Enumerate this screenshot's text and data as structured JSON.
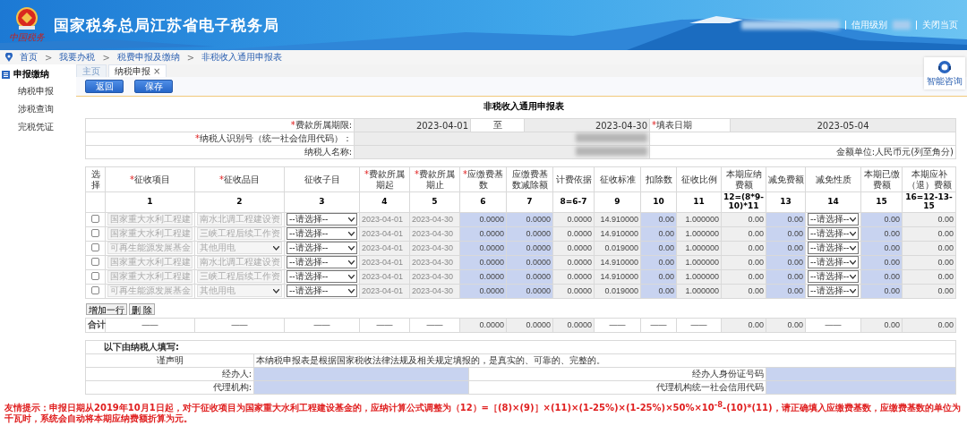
{
  "header": {
    "title": "国家税务总局江苏省电子税务局",
    "logo_text": "中国税务",
    "links": [
      {
        "label": "信用级别"
      },
      {
        "label": "关闭当页"
      }
    ]
  },
  "breadcrumb": [
    {
      "label": "首页"
    },
    {
      "sep": ">",
      "label": "我要办税"
    },
    {
      "sep": ">",
      "label": "税费申报及缴纳"
    },
    {
      "sep": ">",
      "label": "非税收入通用申报表"
    }
  ],
  "sidebar": {
    "title": "申报缴纳",
    "items": [
      {
        "label": "纳税申报"
      },
      {
        "label": "涉税查询"
      },
      {
        "label": "完税凭证"
      }
    ]
  },
  "tabs": [
    {
      "label": "主页",
      "selected": false
    },
    {
      "label": "纳税申报",
      "selected": true,
      "close": "×"
    }
  ],
  "buttons": [
    "返回",
    "保存"
  ],
  "help": {
    "label": "智能咨询"
  },
  "form": {
    "title": "非税收入通用申报表",
    "period": {
      "mark": "*",
      "label": "费款所属期限:",
      "start": "2023-04-01",
      "sep": "至",
      "end": "2023-04-30"
    },
    "fill_date": {
      "mark": "*",
      "label": "填表日期",
      "value": "2023-05-04"
    },
    "taxpayer_id": {
      "mark": "*",
      "label": "纳税人识别号（统一社会信用代码）："
    },
    "taxpayer_name": {
      "label": "纳税人名称:"
    },
    "unit": "金额单位:人民币元(列至角分)"
  },
  "table": {
    "columns": [
      {
        "label": "选择"
      },
      {
        "mark": "*",
        "label": "征收项目",
        "number": "1"
      },
      {
        "mark": "*",
        "label": "征收品目",
        "number": "2"
      },
      {
        "label": "征收子目",
        "number": "3"
      },
      {
        "mark": "*",
        "label": "费款所属期起",
        "number": "4"
      },
      {
        "mark": "*",
        "label": "费款所属期止",
        "number": "5"
      },
      {
        "mark": "*",
        "label": "应缴费基数",
        "number": "6"
      },
      {
        "label": "应缴费基数减除额",
        "number": "7"
      },
      {
        "label": "计费依据",
        "number": "8=6-7"
      },
      {
        "label": "征收标准",
        "number": "9"
      },
      {
        "label": "扣除数",
        "number": "10"
      },
      {
        "label": "征收比例",
        "number": "11"
      },
      {
        "label": "本期应纳费额",
        "number": "12=(8*9-10)*11"
      },
      {
        "label": "减免费额",
        "number": "13"
      },
      {
        "label": "减免性质",
        "number": "14"
      },
      {
        "label": "本期已缴费额",
        "number": "15"
      },
      {
        "label": "本期应补（退）费额",
        "number": "16=12-13-15"
      }
    ],
    "rows": [
      {
        "cells": [
          {
            "kind": "checkbox",
            "checked": false
          },
          {
            "kind": "select",
            "value": "国家重大水利工程建",
            "disabled": true
          },
          {
            "kind": "select",
            "value": "南水北调工程建设资",
            "disabled": true
          },
          {
            "kind": "select",
            "value": "--请选择--",
            "disabled": false
          },
          {
            "kind": "readonly",
            "value": "2023-04-01"
          },
          {
            "kind": "readonly",
            "value": "2023-04-30"
          },
          {
            "kind": "input",
            "value": "0.0000"
          },
          {
            "kind": "input",
            "value": "0.0000"
          },
          {
            "kind": "readonly",
            "value": "0.0000"
          },
          {
            "kind": "readonly",
            "value": "14.910000"
          },
          {
            "kind": "input",
            "value": "0.00"
          },
          {
            "kind": "readonly",
            "value": "1.000000"
          },
          {
            "kind": "readonly",
            "value": "0.00"
          },
          {
            "kind": "input",
            "value": "0.00"
          },
          {
            "kind": "select",
            "value": "--请选择--",
            "disabled": false
          },
          {
            "kind": "input",
            "value": "0.00"
          },
          {
            "kind": "readonly",
            "value": "0.00"
          }
        ]
      },
      {
        "cells": [
          {
            "kind": "checkbox",
            "checked": false
          },
          {
            "kind": "select",
            "value": "国家重大水利工程建",
            "disabled": true
          },
          {
            "kind": "select",
            "value": "三峡工程后续工作资",
            "disabled": true
          },
          {
            "kind": "select",
            "value": "--请选择--",
            "disabled": false
          },
          {
            "kind": "readonly",
            "value": "2023-04-01"
          },
          {
            "kind": "readonly",
            "value": "2023-04-30"
          },
          {
            "kind": "input",
            "value": "0.0000"
          },
          {
            "kind": "input",
            "value": "0.0000"
          },
          {
            "kind": "readonly",
            "value": "0.0000"
          },
          {
            "kind": "readonly",
            "value": "14.910000"
          },
          {
            "kind": "input",
            "value": "0.00"
          },
          {
            "kind": "readonly",
            "value": "1.000000"
          },
          {
            "kind": "readonly",
            "value": "0.00"
          },
          {
            "kind": "input",
            "value": "0.00"
          },
          {
            "kind": "select",
            "value": "--请选择--",
            "disabled": false
          },
          {
            "kind": "input",
            "value": "0.00"
          },
          {
            "kind": "readonly",
            "value": "0.00"
          }
        ]
      },
      {
        "cells": [
          {
            "kind": "checkbox",
            "checked": false
          },
          {
            "kind": "select",
            "value": "可再生能源发展基金",
            "disabled": true
          },
          {
            "kind": "select",
            "value": "其他用电",
            "disabled": true
          },
          {
            "kind": "select",
            "value": "--请选择--",
            "disabled": false
          },
          {
            "kind": "readonly",
            "value": "2023-04-01"
          },
          {
            "kind": "readonly",
            "value": "2023-04-30"
          },
          {
            "kind": "input",
            "value": "0.0000"
          },
          {
            "kind": "input",
            "value": "0.0000"
          },
          {
            "kind": "readonly",
            "value": "0.0000"
          },
          {
            "kind": "readonly",
            "value": "0.019000"
          },
          {
            "kind": "input",
            "value": "0.00"
          },
          {
            "kind": "readonly",
            "value": "1.000000"
          },
          {
            "kind": "readonly",
            "value": "0.00"
          },
          {
            "kind": "input",
            "value": "0.00"
          },
          {
            "kind": "select",
            "value": "--请选择--",
            "disabled": false
          },
          {
            "kind": "input",
            "value": "0.00"
          },
          {
            "kind": "readonly",
            "value": "0.00"
          }
        ]
      },
      {
        "cells": [
          {
            "kind": "checkbox",
            "checked": false
          },
          {
            "kind": "select",
            "value": "国家重大水利工程建",
            "disabled": true
          },
          {
            "kind": "select",
            "value": "南水北调工程建设资",
            "disabled": true
          },
          {
            "kind": "select",
            "value": "--请选择--",
            "disabled": false
          },
          {
            "kind": "readonly",
            "value": "2023-04-01"
          },
          {
            "kind": "readonly",
            "value": "2023-04-30"
          },
          {
            "kind": "input",
            "value": "0.0000"
          },
          {
            "kind": "input",
            "value": "0.0000"
          },
          {
            "kind": "readonly",
            "value": "0.0000"
          },
          {
            "kind": "readonly",
            "value": "14.910000"
          },
          {
            "kind": "input",
            "value": "0.00"
          },
          {
            "kind": "readonly",
            "value": "1.000000"
          },
          {
            "kind": "readonly",
            "value": "0.00"
          },
          {
            "kind": "input",
            "value": "0.00"
          },
          {
            "kind": "select",
            "value": "--请选择--",
            "disabled": false
          },
          {
            "kind": "input",
            "value": "0.00"
          },
          {
            "kind": "readonly",
            "value": "0.00"
          }
        ]
      },
      {
        "cells": [
          {
            "kind": "checkbox",
            "checked": false
          },
          {
            "kind": "select",
            "value": "国家重大水利工程建",
            "disabled": true
          },
          {
            "kind": "select",
            "value": "三峡工程后续工作资",
            "disabled": true
          },
          {
            "kind": "select",
            "value": "--请选择--",
            "disabled": false
          },
          {
            "kind": "readonly",
            "value": "2023-04-01"
          },
          {
            "kind": "readonly",
            "value": "2023-04-30"
          },
          {
            "kind": "input",
            "value": "0.0000"
          },
          {
            "kind": "input",
            "value": "0.0000"
          },
          {
            "kind": "readonly",
            "value": "0.0000"
          },
          {
            "kind": "readonly",
            "value": "14.910000"
          },
          {
            "kind": "input",
            "value": "0.00"
          },
          {
            "kind": "readonly",
            "value": "1.000000"
          },
          {
            "kind": "readonly",
            "value": "0.00"
          },
          {
            "kind": "input",
            "value": "0.00"
          },
          {
            "kind": "select",
            "value": "--请选择--",
            "disabled": false
          },
          {
            "kind": "input",
            "value": "0.00"
          },
          {
            "kind": "readonly",
            "value": "0.00"
          }
        ]
      },
      {
        "cells": [
          {
            "kind": "checkbox",
            "checked": false
          },
          {
            "kind": "select",
            "value": "可再生能源发展基金",
            "disabled": true
          },
          {
            "kind": "select",
            "value": "其他用电",
            "disabled": true
          },
          {
            "kind": "select",
            "value": "--请选择--",
            "disabled": false
          },
          {
            "kind": "readonly",
            "value": "2023-04-01"
          },
          {
            "kind": "readonly",
            "value": "2023-04-30"
          },
          {
            "kind": "input",
            "value": "0.0000"
          },
          {
            "kind": "input",
            "value": "0.0000"
          },
          {
            "kind": "readonly",
            "value": "0.0000"
          },
          {
            "kind": "readonly",
            "value": "0.019000"
          },
          {
            "kind": "input",
            "value": "0.00"
          },
          {
            "kind": "readonly",
            "value": "1.000000"
          },
          {
            "kind": "readonly",
            "value": "0.00"
          },
          {
            "kind": "input",
            "value": "0.00"
          },
          {
            "kind": "select",
            "value": "--请选择--",
            "disabled": false
          },
          {
            "kind": "input",
            "value": "0.00"
          },
          {
            "kind": "readonly",
            "value": "0.00"
          }
        ]
      }
    ],
    "row_buttons": [
      "增加一行",
      "删 除"
    ],
    "total": {
      "cells": [
        {
          "kind": "label",
          "value": "合计"
        },
        {
          "kind": "text",
          "value": "——"
        },
        {
          "kind": "text",
          "value": "——"
        },
        {
          "kind": "text",
          "value": "——"
        },
        {
          "kind": "text",
          "value": "——"
        },
        {
          "kind": "text",
          "value": "——"
        },
        {
          "kind": "readonly",
          "value": "0.0000"
        },
        {
          "kind": "readonly",
          "value": "0.0000"
        },
        {
          "kind": "readonly",
          "value": "0.0000"
        },
        {
          "kind": "text",
          "value": "——"
        },
        {
          "kind": "text",
          "value": "——"
        },
        {
          "kind": "text",
          "value": "——"
        },
        {
          "kind": "readonly",
          "value": "0.00"
        },
        {
          "kind": "readonly",
          "value": "0.00"
        },
        {
          "kind": "text",
          "value": "——"
        },
        {
          "kind": "readonly",
          "value": "0.00"
        },
        {
          "kind": "readonly",
          "value": "0.00"
        }
      ]
    }
  },
  "declaration": {
    "title": "以下由纳税人填写:",
    "statement_label": "谨声明",
    "statement": "本纳税申报表是根据国家税收法律法规及相关规定填报的，是真实的、可靠的、完整的。",
    "fields": [
      {
        "label": "经办人:"
      },
      {
        "label": "经办人身份证号码"
      },
      {
        "label": "代理机构:"
      },
      {
        "label": "代理机构统一社会信用代码"
      }
    ]
  },
  "tip": "友情提示：申报日期从2019年10月1日起，对于征收项目为国家重大水利工程建设基金的，应纳计算公式调整为（12）=［(8)×(9)］×(11)×(1-25%)×(1-25%)×50%×10$^{-8}$-(10)*(11)，请正确填入应缴费基数，应缴费基数的单位为千瓦时，系统会自动将本期应纳费额折算为元。"
}
